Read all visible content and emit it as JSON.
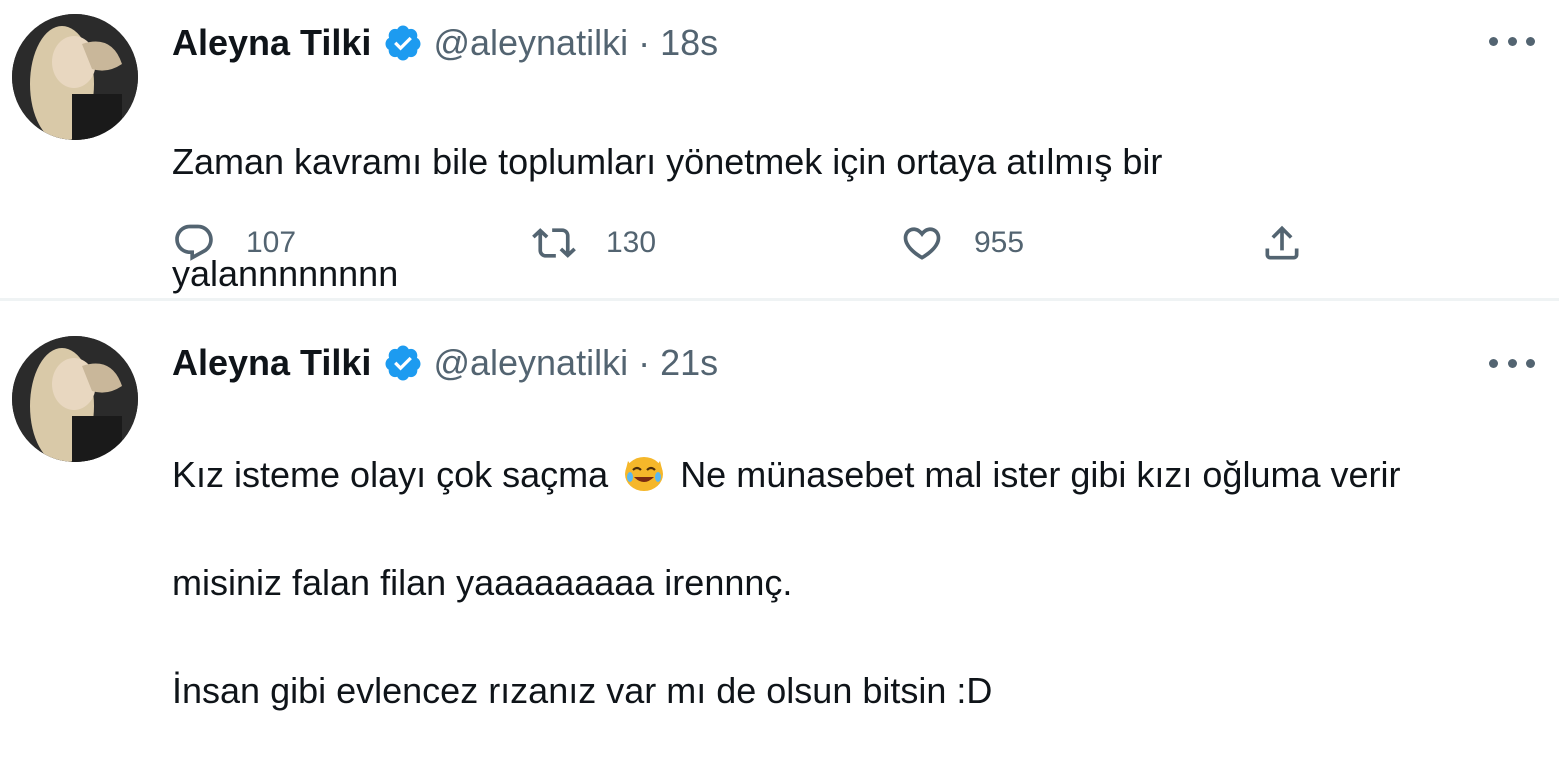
{
  "tweets": [
    {
      "author_name": "Aleyna Tilki",
      "handle": "@aleynatilki",
      "separator": "·",
      "time": "18s",
      "text_lines": [
        "Zaman kavramı bile toplumları yönetmek için ortaya atılmış bir",
        "yalannnnnnnn"
      ],
      "replies": "107",
      "retweets": "130",
      "likes": "955"
    },
    {
      "author_name": "Aleyna Tilki",
      "handle": "@aleynatilki",
      "separator": "·",
      "time": "21s",
      "text_line1_before": "Kız isteme olayı çok saçma",
      "text_line1_after": "Ne münasebet mal ister gibi kızı oğluma verir",
      "text_lines": [
        "misiniz falan filan yaaaaaaaaa irennnç.",
        "İnsan gibi evlencez rızanız var mı de olsun bitsin :D"
      ]
    }
  ],
  "icons": {
    "verified": "verified-badge-icon",
    "more": "more-options-icon",
    "reply": "reply-icon",
    "retweet": "retweet-icon",
    "like": "heart-icon",
    "share": "share-icon",
    "emoji": "laughing-emoji-icon"
  },
  "colors": {
    "verified_blue": "#1d9bf0",
    "text": "#0f1419",
    "secondary_text": "#536471",
    "divider": "#eff3f4"
  }
}
